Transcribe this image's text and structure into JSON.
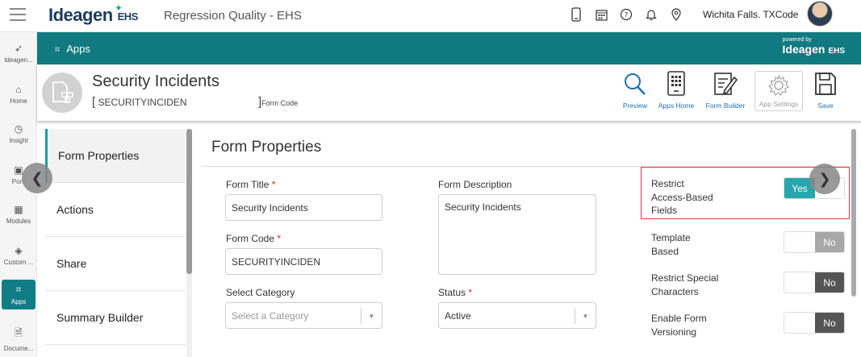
{
  "topbar": {
    "logo": "Ideagen",
    "logo_suffix": "EHS",
    "subtitle": "Regression Quality - EHS",
    "location": "Wichita Falls. TXCode",
    "icons": [
      "mobile-icon",
      "calendar-icon",
      "help-icon",
      "bell-icon",
      "location-pin-icon"
    ]
  },
  "leftnav": {
    "items": [
      {
        "label": "Ideagen...",
        "icon": "ideagen-icon"
      },
      {
        "label": "Home",
        "icon": "home-icon"
      },
      {
        "label": "Insight",
        "icon": "pie-chart-icon"
      },
      {
        "label": "Portl",
        "icon": "portal-icon"
      },
      {
        "label": "Modules",
        "icon": "grid-icon"
      },
      {
        "label": "Custom ...",
        "icon": "layers-icon"
      },
      {
        "label": "Apps",
        "icon": "apps-icon",
        "active": true
      },
      {
        "label": "Docume...",
        "icon": "document-icon"
      }
    ]
  },
  "appsbar": {
    "label": "Apps",
    "powered_by": "powered by",
    "powered_logo": "Ideagen",
    "powered_suffix": "EHS"
  },
  "header": {
    "title": "Security Incidents",
    "code_open": "[",
    "code": "SECURITYINCIDEN",
    "code_close": "]",
    "code_label": "Form Code",
    "tools": [
      {
        "label": "Preview",
        "icon": "search-icon"
      },
      {
        "label": "Apps Home",
        "icon": "apps-home-icon"
      },
      {
        "label": "Form Builder",
        "icon": "form-builder-icon"
      },
      {
        "label": "App Settings",
        "icon": "gear-icon",
        "disabled": true
      },
      {
        "label": "Save",
        "icon": "save-icon"
      }
    ]
  },
  "tabs": [
    "Form Properties",
    "Actions",
    "Share",
    "Summary Builder"
  ],
  "main": {
    "title": "Form Properties",
    "required_mark": "*",
    "form_title_label": "Form Title",
    "form_title_value": "Security Incidents",
    "form_code_label": "Form Code",
    "form_code_value": "SECURITYINCIDEN",
    "select_category_label": "Select Category",
    "select_category_placeholder": "Select a Category",
    "form_description_label": "Form Description",
    "form_description_value": "Security Incidents",
    "status_label": "Status",
    "status_value": "Active"
  },
  "toggles": [
    {
      "label_lines": [
        "Restrict",
        "Access-Based",
        "Fields"
      ],
      "value": "Yes"
    },
    {
      "label_lines": [
        "Template",
        "Based"
      ],
      "value": "No"
    },
    {
      "label_lines": [
        "Restrict Special",
        "Characters"
      ],
      "value": "No"
    },
    {
      "label_lines": [
        "Enable Form",
        "Versioning"
      ],
      "value": "No"
    }
  ],
  "colors": {
    "teal": "#107a80",
    "accent": "#16a0a6",
    "link": "#1f6fb2",
    "highlight": "#e0383e"
  }
}
